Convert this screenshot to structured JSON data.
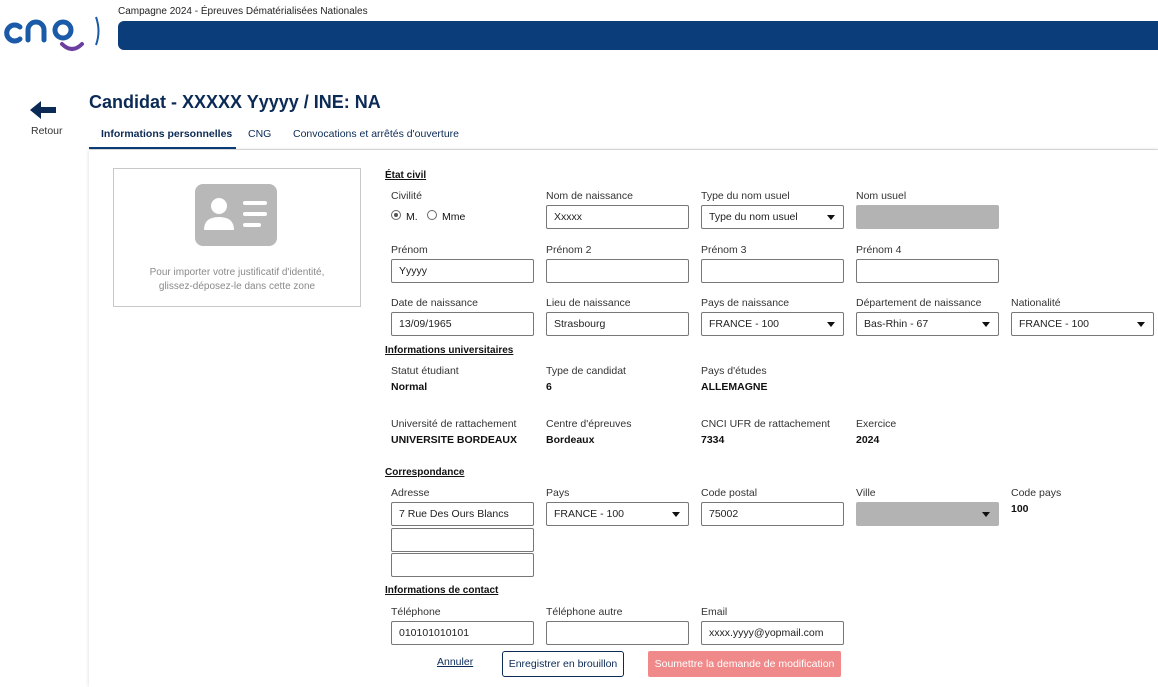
{
  "header": {
    "campaign_title": "Campagne 2024 - Épreuves Dématérialisées Nationales",
    "brand_colors": {
      "primary": "#0b3d7a",
      "accent": "#6b3fa0"
    }
  },
  "nav": {
    "back_label": "Retour"
  },
  "page": {
    "title": "Candidat - XXXXX Yyyyy / INE: NA"
  },
  "tabs": [
    {
      "label": "Informations personnelles",
      "active": true
    },
    {
      "label": "CNG",
      "active": false
    },
    {
      "label": "Convocations et arrêtés d'ouverture",
      "active": false
    }
  ],
  "dropzone": {
    "icon": "id-card-icon",
    "line1": "Pour importer votre justificatif d'identité,",
    "line2": "glissez-déposez-le dans cette zone"
  },
  "etat_civil": {
    "section_title": "État civil",
    "civilite": {
      "label": "Civilité",
      "options": [
        "M.",
        "Mme"
      ],
      "selected": "M."
    },
    "nom_naissance": {
      "label": "Nom de naissance",
      "value": "Xxxxx"
    },
    "type_nom_usuel": {
      "label": "Type du nom usuel",
      "value": "Type du nom usuel"
    },
    "nom_usuel": {
      "label": "Nom usuel",
      "value": ""
    },
    "prenom": {
      "label": "Prénom",
      "value": "Yyyyy"
    },
    "prenom2": {
      "label": "Prénom 2",
      "value": ""
    },
    "prenom3": {
      "label": "Prénom 3",
      "value": ""
    },
    "prenom4": {
      "label": "Prénom 4",
      "value": ""
    },
    "date_naissance": {
      "label": "Date de naissance",
      "value": "13/09/1965"
    },
    "lieu_naissance": {
      "label": "Lieu de naissance",
      "value": "Strasbourg"
    },
    "pays_naissance": {
      "label": "Pays de naissance",
      "value": "FRANCE - 100"
    },
    "departement_naissance": {
      "label": "Département de naissance",
      "value": "Bas-Rhin - 67"
    },
    "nationalite": {
      "label": "Nationalité",
      "value": "FRANCE - 100"
    }
  },
  "universitaires": {
    "section_title": "Informations universitaires",
    "statut": {
      "label": "Statut étudiant",
      "value": "Normal"
    },
    "type_candidat": {
      "label": "Type de candidat",
      "value": "6"
    },
    "pays_etudes": {
      "label": "Pays d'études",
      "value": "ALLEMAGNE"
    },
    "universite": {
      "label": "Université de rattachement",
      "value": "UNIVERSITE BORDEAUX"
    },
    "centre": {
      "label": "Centre d'épreuves",
      "value": "Bordeaux"
    },
    "cnci": {
      "label": "CNCI UFR de rattachement",
      "value": "7334"
    },
    "exercice": {
      "label": "Exercice",
      "value": "2024"
    }
  },
  "correspondance": {
    "section_title": "Correspondance",
    "adresse": {
      "label": "Adresse",
      "line1": "7 Rue Des Ours Blancs",
      "line2": "",
      "line3": ""
    },
    "pays": {
      "label": "Pays",
      "value": "FRANCE - 100"
    },
    "code_postal": {
      "label": "Code postal",
      "value": "75002"
    },
    "ville": {
      "label": "Ville",
      "value": ""
    },
    "code_pays": {
      "label": "Code pays",
      "value": "100"
    }
  },
  "contact": {
    "section_title": "Informations de contact",
    "telephone": {
      "label": "Téléphone",
      "value": "010101010101"
    },
    "telephone_autre": {
      "label": "Téléphone autre",
      "value": ""
    },
    "email": {
      "label": "Email",
      "value": "xxxx.yyyy@yopmail.com"
    }
  },
  "actions": {
    "cancel": "Annuler",
    "save_draft": "Enregistrer en brouillon",
    "submit": "Soumettre la demande de modification",
    "submit_color": "#f08a8a"
  }
}
